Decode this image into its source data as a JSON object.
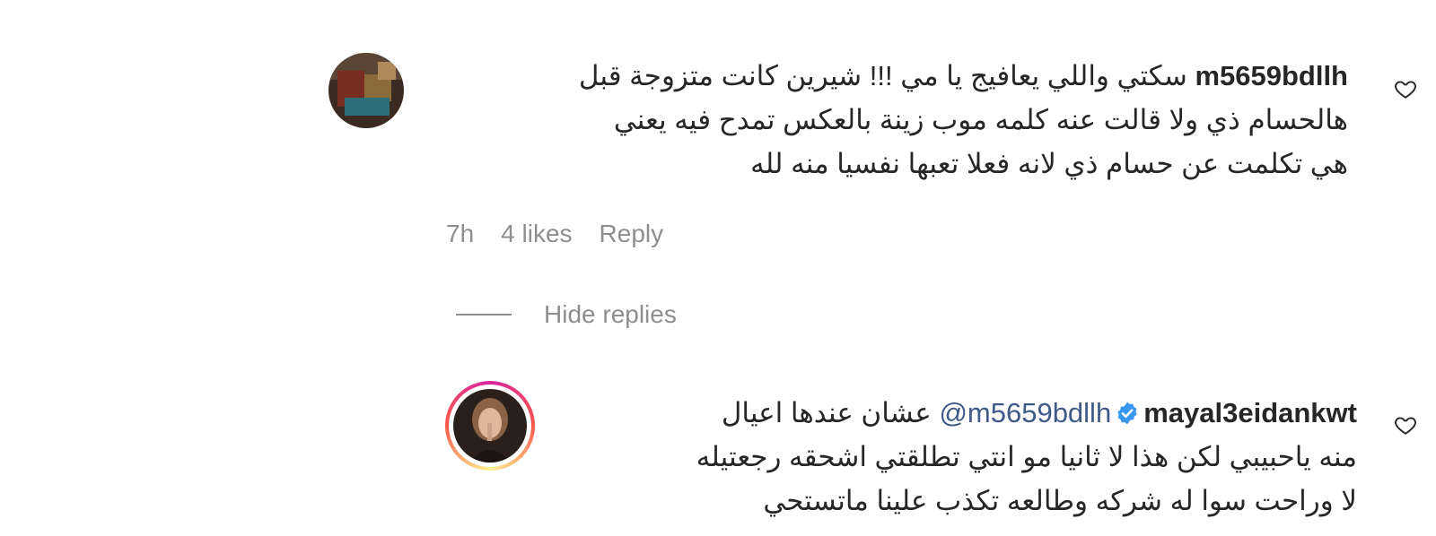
{
  "comment": {
    "username": "m5659bdllh",
    "lines": [
      "سكتي واللي يعافيج يا مي !!! شيرين كانت متزوجة قبل",
      "هالحسام ذي ولا قالت عنه كلمه موب زينة بالعكس تمدح فيه يعني",
      "هي تكلمت عن حسام ذي لانه فعلا تعبها نفسيا منه لله"
    ],
    "time": "7h",
    "likes": "4 likes",
    "reply_label": "Reply",
    "like_icon": "heart-outline-icon"
  },
  "hide_replies_label": "Hide replies",
  "reply": {
    "username": "mayal3eidankwt",
    "verified_icon": "verified-badge-icon",
    "mention": "@m5659bdllh",
    "first_line_text": "عشان عندها اعيال",
    "lines": [
      "منه ياحبيبي لكن هذا لا ثانيا مو انتي تطلقتي اشحقه رجعتيله",
      "لا وراحت سوا له شركه وطالعه تكذب علينا ماتستحي"
    ],
    "like_icon": "heart-outline-icon"
  },
  "colors": {
    "text": "#262626",
    "muted": "#8e8e8e",
    "mention": "#3f5a86",
    "verified": "#3897f0"
  }
}
